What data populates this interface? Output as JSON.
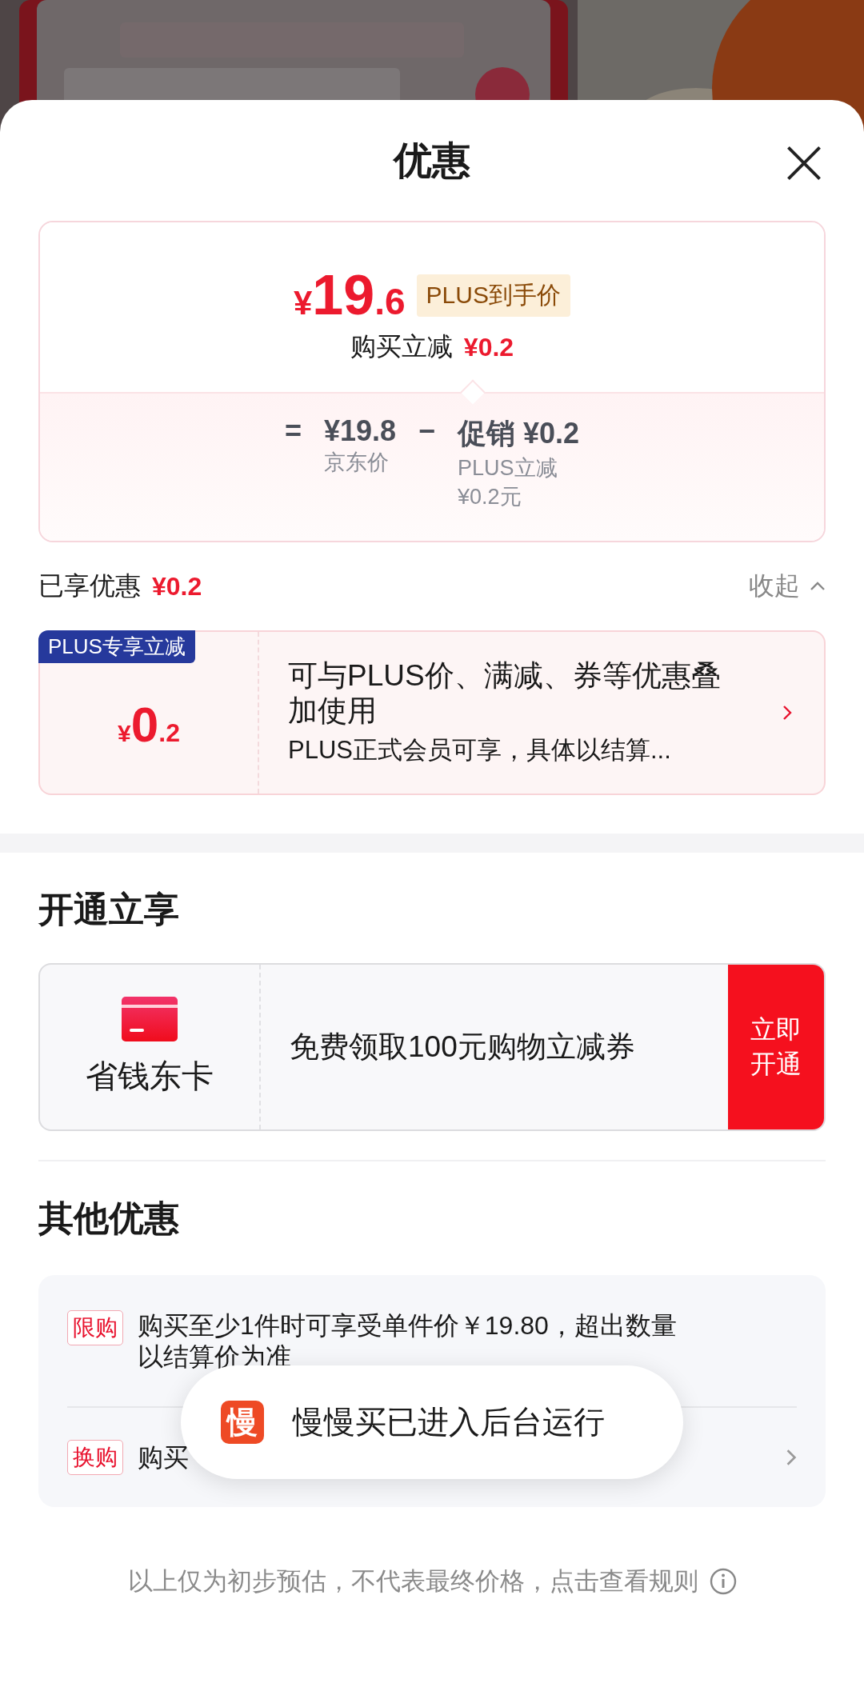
{
  "sheet": {
    "title": "优惠"
  },
  "price_summary": {
    "currency": "¥",
    "price_integer": "19",
    "price_decimal": ".6",
    "badge": "PLUS到手价",
    "instant_label": "购买立减",
    "instant_amount": "¥0.2",
    "breakdown": {
      "equals": "=",
      "base_price": "¥19.8",
      "base_label": "京东价",
      "minus": "−",
      "promo_label": "促销",
      "promo_amount": "¥0.2",
      "promo_details": [
        "PLUS立减",
        "¥0.2元"
      ]
    }
  },
  "enjoyed": {
    "label": "已享优惠",
    "amount": "¥0.2",
    "toggle": "收起",
    "expanded": true
  },
  "discount_cards": [
    {
      "tag": "PLUS专享立减",
      "currency": "¥",
      "amount_integer": "0",
      "amount_decimal": ".2",
      "title": "可与PLUS价、满减、券等优惠叠加使用",
      "note": "PLUS正式会员可享，具体以结算..."
    }
  ],
  "membership": {
    "heading": "开通立享",
    "card": {
      "name": "省钱东卡",
      "offer": "免费领取100元购物立减券",
      "button": "立即开通"
    }
  },
  "other_offers": {
    "heading": "其他优惠",
    "rows": [
      {
        "tag": "限购",
        "text": "购买至少1件时可享受单件价￥19.80，超出数量以结算价为准",
        "has_arrow": false
      },
      {
        "tag": "换购",
        "text": "购买",
        "has_arrow": true
      }
    ]
  },
  "toast": {
    "app_icon": "慢",
    "message": "慢慢买已进入后台运行"
  },
  "footer": {
    "text": "以上仅为初步预估，不代表最终价格，点击查看规则"
  }
}
